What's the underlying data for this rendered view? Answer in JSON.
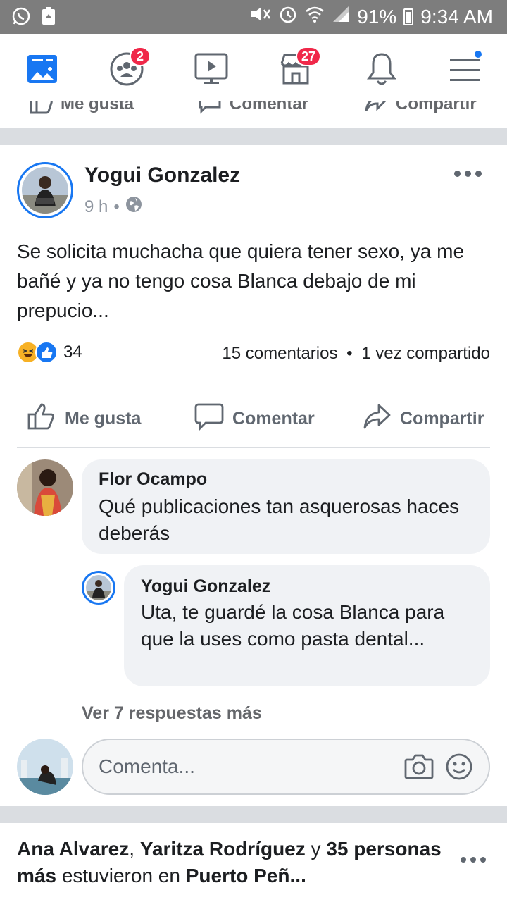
{
  "status_bar": {
    "battery": "91%",
    "time": "9:34 AM",
    "icons": [
      "whatsapp-icon",
      "recycle-icon",
      "mute-icon",
      "alarm-icon",
      "wifi-icon",
      "signal-icon",
      "battery-icon"
    ]
  },
  "nav": {
    "items": [
      {
        "name": "news-feed",
        "icon": "news-feed-icon",
        "active": true
      },
      {
        "name": "groups",
        "icon": "groups-icon",
        "badge": "2"
      },
      {
        "name": "watch",
        "icon": "video-icon"
      },
      {
        "name": "marketplace",
        "icon": "marketplace-icon",
        "badge": "27"
      },
      {
        "name": "notifications",
        "icon": "bell-icon"
      },
      {
        "name": "menu",
        "icon": "hamburger-icon",
        "dot": true
      }
    ]
  },
  "partial_actions": {
    "like": "Me gusta",
    "comment": "Comentar",
    "share": "Compartir"
  },
  "post": {
    "author": "Yogui Gonzalez",
    "time": "9 h",
    "audience_icon": "globe-icon",
    "text": "Se solicita muchacha que quiera tener sexo, ya me bañé y ya no tengo cosa Blanca debajo de mi prepucio...",
    "reaction_icons": [
      "haha-icon",
      "like-icon"
    ],
    "reaction_count": "34",
    "comments_count": "15 comentarios",
    "shares_count": "1 vez compartido",
    "counts_separator": "•",
    "actions": {
      "like": "Me gusta",
      "comment": "Comentar",
      "share": "Compartir"
    }
  },
  "comments": [
    {
      "author": "Flor Ocampo",
      "text": "Qué publicaciones tan asquerosas haces deberás"
    },
    {
      "author": "Yogui Gonzalez",
      "text": "Uta, te guardé la cosa Blanca para que la uses como pasta dental..."
    }
  ],
  "view_more_replies": "Ver 7 respuestas más",
  "composer": {
    "placeholder": "Comenta..."
  },
  "next_post": {
    "name1": "Ana Alvarez",
    "sep1": ", ",
    "name2": "Yaritza Rodríguez",
    "and": " y ",
    "others": "35 personas más",
    "verb": " estuvieron en ",
    "place": "Puerto Peñ..."
  },
  "colors": {
    "accent": "#1877f2",
    "badge": "#f02849",
    "status_bar": "#7d7d7d",
    "separator": "#dadde1"
  }
}
